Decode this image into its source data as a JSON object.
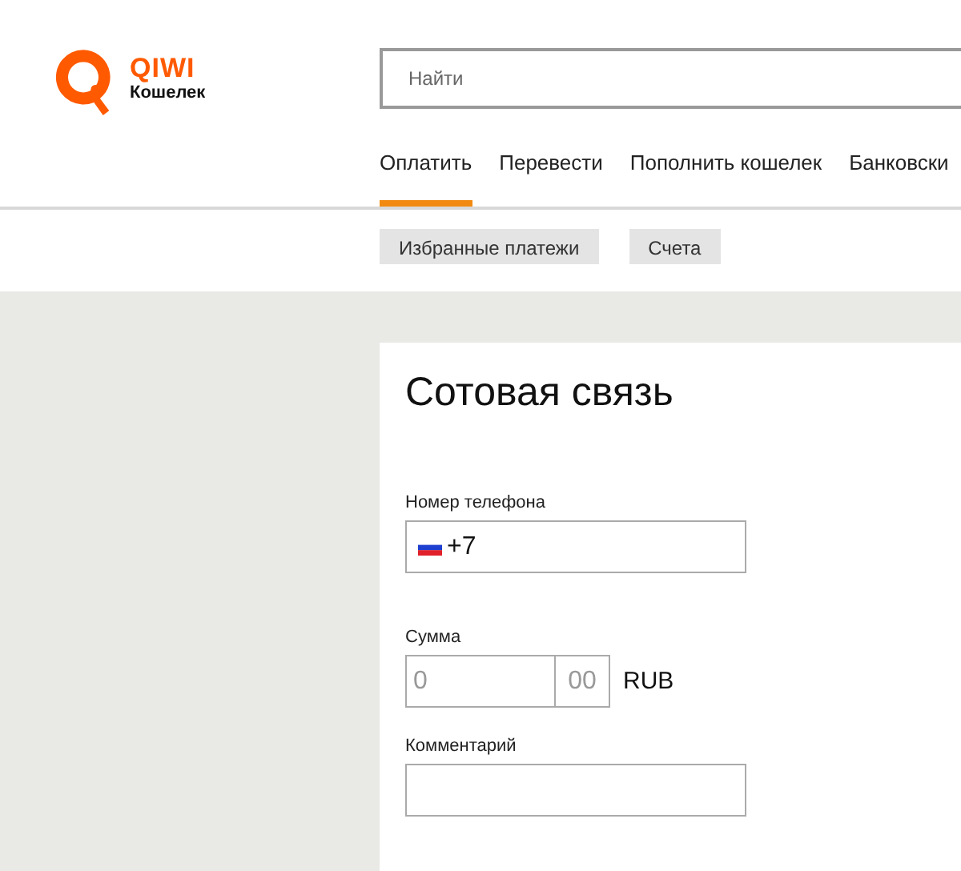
{
  "logo": {
    "brand": "QIWI",
    "subtitle": "Кошелек"
  },
  "search": {
    "placeholder": "Найти"
  },
  "nav": [
    {
      "label": "Оплатить",
      "selected": true
    },
    {
      "label": "Перевести",
      "selected": false
    },
    {
      "label": "Пополнить кошелек",
      "selected": false
    },
    {
      "label": "Банковски",
      "selected": false
    }
  ],
  "subnav": [
    {
      "label": "Избранные платежи"
    },
    {
      "label": "Счета"
    }
  ],
  "form": {
    "title": "Сотовая связь",
    "phone": {
      "label": "Номер телефона",
      "value": "+7"
    },
    "amount": {
      "label": "Сумма",
      "rubles_placeholder": "0",
      "kopecks_placeholder": "00",
      "currency": "RUB"
    },
    "comment": {
      "label": "Комментарий"
    }
  }
}
